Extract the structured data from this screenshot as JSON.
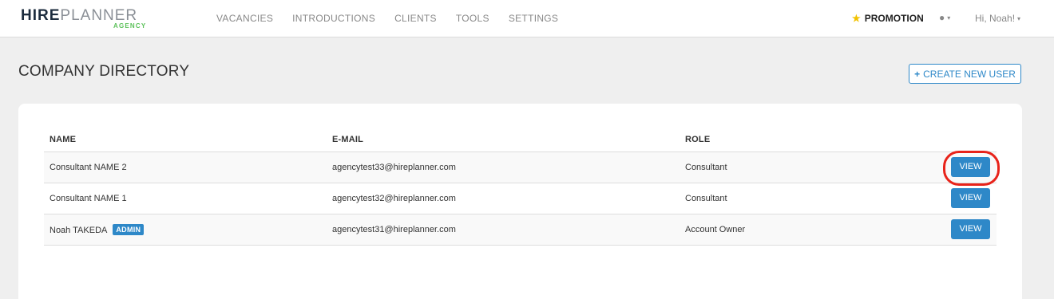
{
  "brand": {
    "hire": "HIRE",
    "planner": "PLANNER",
    "sub": "AGENCY"
  },
  "nav": [
    "VACANCIES",
    "INTRODUCTIONS",
    "CLIENTS",
    "TOOLS",
    "SETTINGS"
  ],
  "header": {
    "promotion": "PROMOTION",
    "greeting": "Hi, Noah!"
  },
  "page": {
    "title": "COMPANY DIRECTORY",
    "create_label": "CREATE NEW USER"
  },
  "table": {
    "headers": {
      "name": "NAME",
      "email": "E-MAIL",
      "role": "ROLE"
    },
    "rows": [
      {
        "name": "Consultant NAME 2",
        "email": "agencytest33@hireplanner.com",
        "role": "Consultant",
        "action": "VIEW"
      },
      {
        "name": "Consultant NAME 1",
        "email": "agencytest32@hireplanner.com",
        "role": "Consultant",
        "action": "VIEW"
      },
      {
        "name": "Noah TAKEDA",
        "badge": "ADMIN",
        "email": "agencytest31@hireplanner.com",
        "role": "Account Owner",
        "action": "VIEW"
      }
    ]
  },
  "colors": {
    "accent": "#2e88c8",
    "highlight": "#e8231a",
    "brand_green": "#5cc15a"
  },
  "icons": {
    "promotion": "star-icon",
    "language": "globe-icon",
    "create": "plus-icon"
  }
}
